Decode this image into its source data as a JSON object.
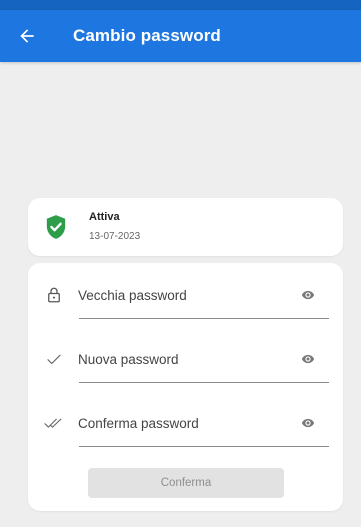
{
  "appbar": {
    "title": "Cambio password",
    "back_icon": "arrow-left-icon",
    "background": "#1e77e0"
  },
  "status": {
    "title": "Attiva",
    "date": "13-07-2023",
    "icon": "shield-check-icon",
    "icon_color": "#2e9e4a"
  },
  "form": {
    "fields": [
      {
        "icon": "lock-icon",
        "placeholder": "Vecchia password",
        "value": "",
        "toggle_icon": "eye-icon"
      },
      {
        "icon": "check-icon",
        "placeholder": "Nuova password",
        "value": "",
        "toggle_icon": "eye-icon"
      },
      {
        "icon": "double-check-icon",
        "placeholder": "Conferma password",
        "value": "",
        "toggle_icon": "eye-icon"
      }
    ],
    "confirm_label": "Conferma"
  }
}
